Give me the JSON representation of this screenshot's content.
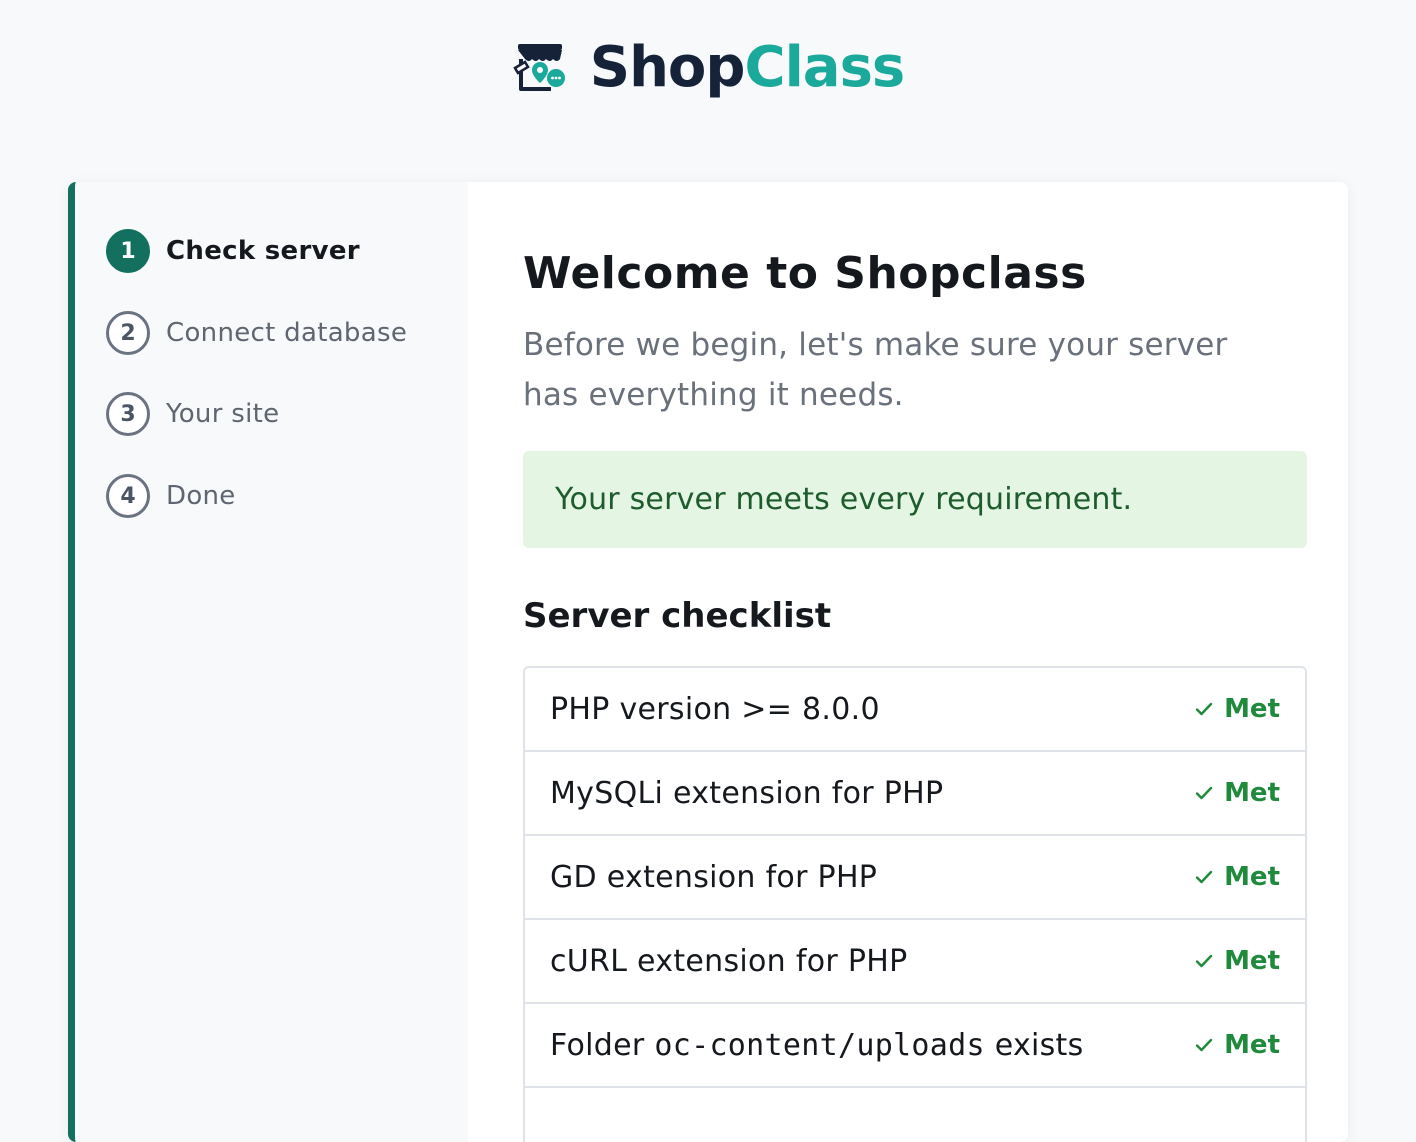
{
  "brand": {
    "name_part1": "Shop",
    "name_part2": "Class",
    "icon": "storefront-icon",
    "color_dark": "#152238",
    "color_accent": "#1aa99a"
  },
  "steps": [
    {
      "number": "1",
      "label": "Check server",
      "active": true
    },
    {
      "number": "2",
      "label": "Connect database",
      "active": false
    },
    {
      "number": "3",
      "label": "Your site",
      "active": false
    },
    {
      "number": "4",
      "label": "Done",
      "active": false
    }
  ],
  "main": {
    "title": "Welcome to Shopclass",
    "intro": "Before we begin, let's make sure your server has everything it needs.",
    "alert": "Your server meets every requirement.",
    "section_title": "Server checklist"
  },
  "checklist": [
    {
      "label": "PHP version >= 8.0.0",
      "status": "Met"
    },
    {
      "label": "MySQLi extension for PHP",
      "status": "Met"
    },
    {
      "label": "GD extension for PHP",
      "status": "Met"
    },
    {
      "label": "cURL extension for PHP",
      "status": "Met"
    },
    {
      "label_prefix": "Folder ",
      "label_code": "oc-content/uploads",
      "label_suffix": " exists",
      "status": "Met"
    }
  ],
  "colors": {
    "primary": "#13705f",
    "success_bg": "#e4f5e4",
    "success_text": "#1e5b2d",
    "met_green": "#1f8a3b"
  }
}
